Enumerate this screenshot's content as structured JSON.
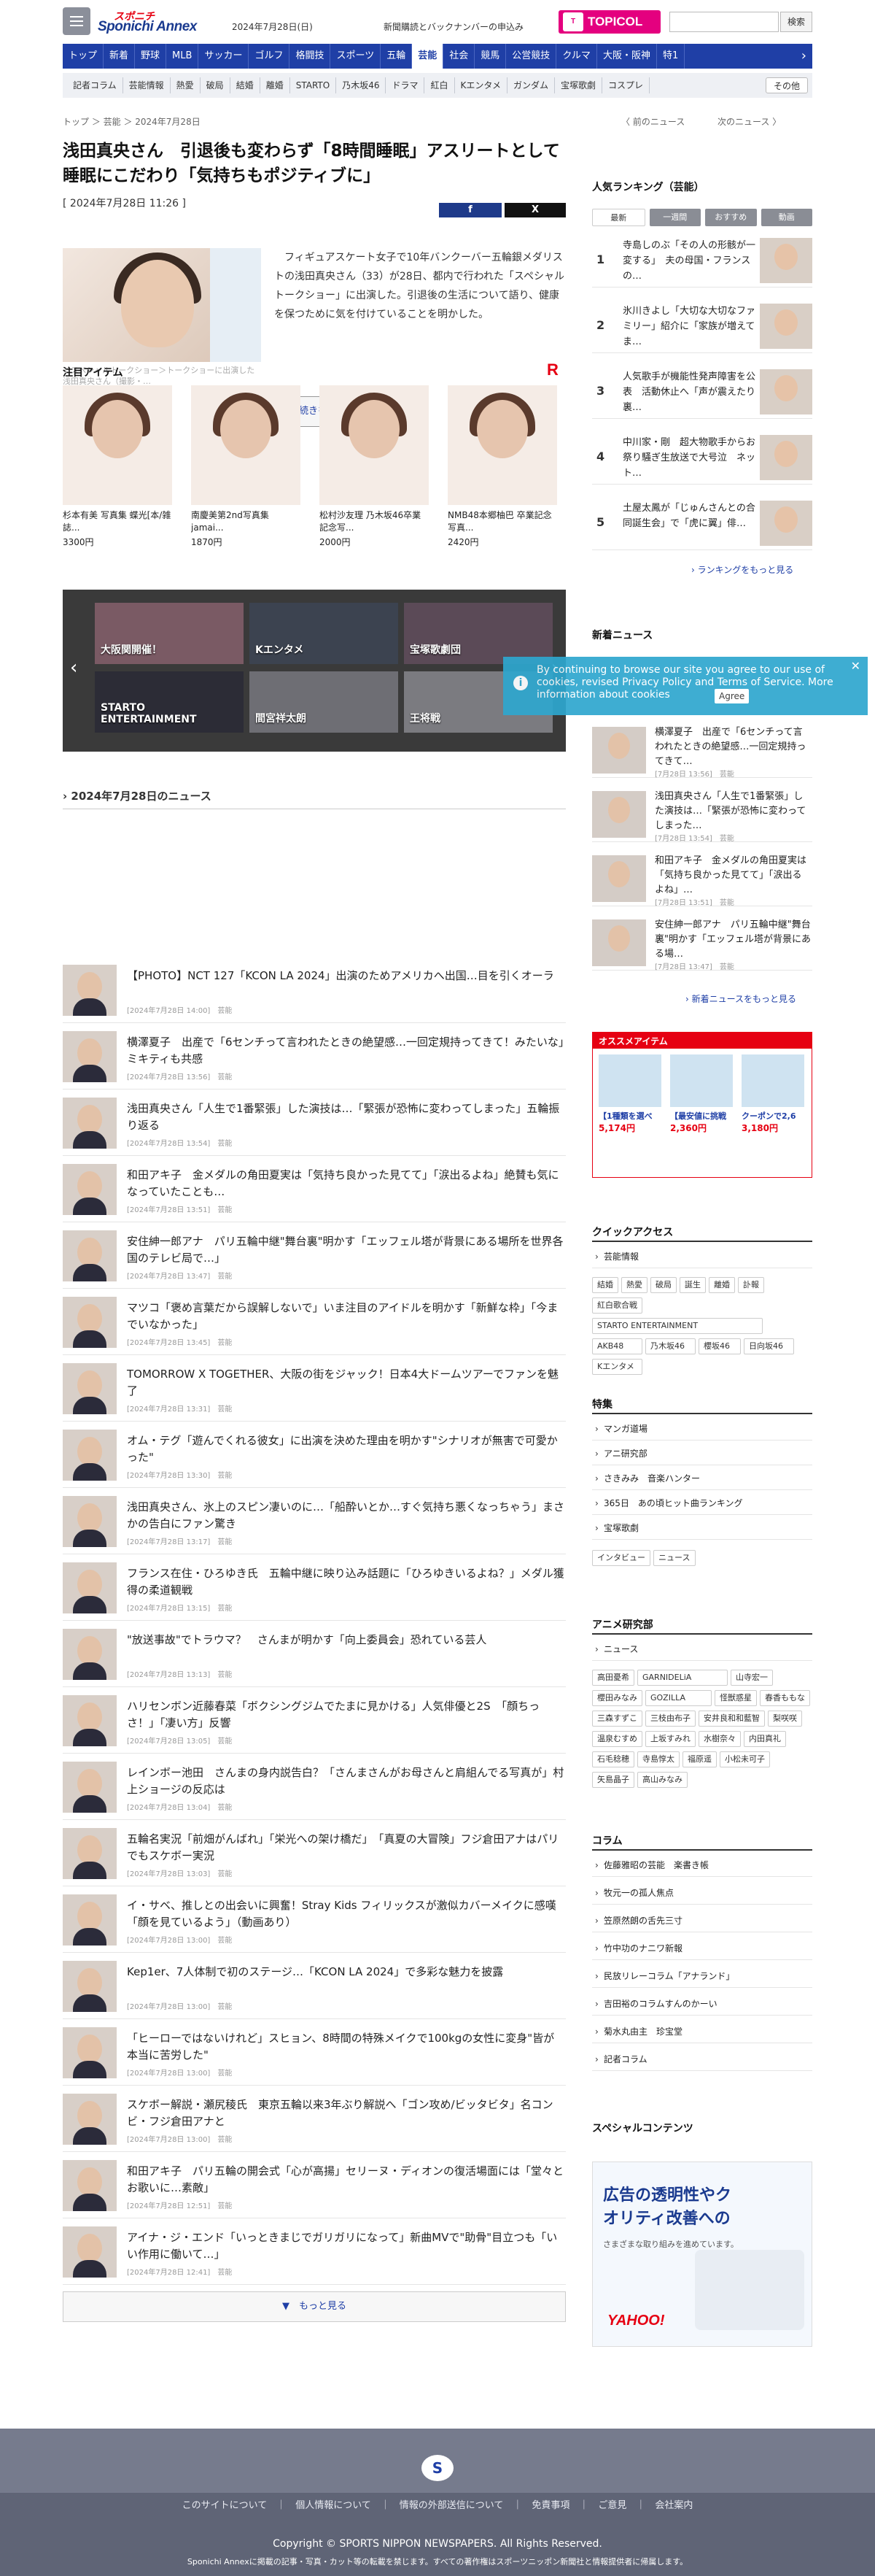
{
  "header": {
    "logo_top": "スポニチ",
    "logo_main": "Sponichi Annex",
    "date": "2024年7月28日(日)",
    "news_link": "新聞購読とバックナンバーの申込み",
    "topicol": "TOPICOL",
    "search_placeholder": "",
    "search_btn": "検索"
  },
  "nav": [
    "トップ",
    "新着",
    "野球",
    "MLB",
    "サッカー",
    "ゴルフ",
    "格闘技",
    "スポーツ",
    "五輪",
    "芸能",
    "社会",
    "競馬",
    "公営競技",
    "クルマ",
    "大阪・阪神",
    "特1"
  ],
  "subnav": [
    "記者コラム",
    "芸能情報",
    "熱愛",
    "破局",
    "結婚",
    "離婚",
    "STARTO",
    "乃木坂46",
    "ドラマ",
    "紅白",
    "Kエンタメ",
    "ガンダム",
    "宝塚歌劇",
    "コスプレ"
  ],
  "subnav_more": "その他",
  "breadcrumb": "トップ ＞ 芸能 ＞ 2024年7月28日",
  "prev": "〈 前のニュース",
  "next": "次のニュース 〉",
  "article": {
    "title": "浅田真央さん　引退後も変わらず「8時間睡眠」アスリートとして睡眠にこだわり「気持ちもポジティブに」",
    "date": "[ 2024年7月28日 11:26 ]",
    "lead": "フィギュアスケート女子で10年バンクーバー五輪銀メダリストの浅田真央さん（33）が28日、都内で行われた「スペシャルトークショー」に出演した。引退後の生活について語り、健康を保つために気を付けていることを明かした。",
    "caption": "＜スペシャルトークショー＞トークショーに出演した浅田真央さん（撮影・…",
    "more": "▼　続きを表示",
    "share_fb": "f",
    "share_x": "X"
  },
  "featured": {
    "title": "注目アイテム",
    "items": [
      {
        "name": "杉本有美 写真集 蝶光[本/雑誌...",
        "price": "3300円"
      },
      {
        "name": "南慶美第2nd写真集 jamai...",
        "price": "1870円"
      },
      {
        "name": "松村沙友理 乃木坂46卒業記念写...",
        "price": "2000円"
      },
      {
        "name": "NMB48本郷柚巴 卒業記念写真...",
        "price": "2420円"
      }
    ]
  },
  "carousel": [
    "大阪関開催！",
    "Kエンタメ",
    "宝塚歌劇団",
    "STARTO ENTERTAINMENT",
    "間宮祥太朗",
    "王将戦"
  ],
  "news": {
    "title": "2024年7月28日のニュース",
    "items": [
      {
        "t": "【PHOTO】NCT 127「KCON LA 2024」出演のためアメリカへ出国…目を引くオーラ",
        "d": "[2024年7月28日 14:00]　芸能"
      },
      {
        "t": "横澤夏子　出産で「6センチって言われたときの絶望感…一回定規持ってきて！みたいな」ミキティも共感",
        "d": "[2024年7月28日 13:56]　芸能"
      },
      {
        "t": "浅田真央さん「人生で1番緊張」した演技は…「緊張が恐怖に変わってしまった」五輪振り返る",
        "d": "[2024年7月28日 13:54]　芸能"
      },
      {
        "t": "和田アキ子　金メダルの角田夏実は「気持ち良かった見てて」「涙出るよね」絶賛も気になっていたことも…",
        "d": "[2024年7月28日 13:51]　芸能"
      },
      {
        "t": "安住紳一郎アナ　パリ五輪中継\"舞台裏\"明かす「エッフェル塔が背景にある場所を世界各国のテレビ局で…」",
        "d": "[2024年7月28日 13:47]　芸能"
      },
      {
        "t": "マツコ「褒め言葉だから誤解しないで」いま注目のアイドルを明かす「新鮮な枠」「今までいなかった」",
        "d": "[2024年7月28日 13:45]　芸能"
      },
      {
        "t": "TOMORROW X TOGETHER、大阪の街をジャック！日本4大ドームツアーでファンを魅了",
        "d": "[2024年7月28日 13:31]　芸能"
      },
      {
        "t": "オム・テグ「遊んでくれる彼女」に出演を決めた理由を明かす\"シナリオが無害で可愛かった\"",
        "d": "[2024年7月28日 13:30]　芸能"
      },
      {
        "t": "浅田真央さん、氷上のスピン凄いのに…「船酔いとか…すぐ気持ち悪くなっちゃう」まさかの告白にファン驚き",
        "d": "[2024年7月28日 13:17]　芸能"
      },
      {
        "t": "フランス在住・ひろゆき氏　五輪中継に映り込み話題に「ひろゆきいるよね？」メダル獲得の柔道観戦",
        "d": "[2024年7月28日 13:15]　芸能"
      },
      {
        "t": "\"放送事故\"でトラウマ？　さんまが明かす「向上委員会」恐れている芸人",
        "d": "[2024年7月28日 13:13]　芸能"
      },
      {
        "t": "ハリセンボン近藤春菜「ボクシングジムでたまに見かける」人気俳優と2S　「顔ちっさ！」「凄い方」反響",
        "d": "[2024年7月28日 13:05]　芸能"
      },
      {
        "t": "レインボー池田　さんまの身内説告白？「さんまさんがお母さんと肩組んでる写真が」村上ショージの反応は",
        "d": "[2024年7月28日 13:04]　芸能"
      },
      {
        "t": "五輪名実況「前畑がんばれ」「栄光への架け橋だ」　「真夏の大冒険」フジ倉田アナはパリでもスケボー実況",
        "d": "[2024年7月28日 13:03]　芸能"
      },
      {
        "t": "イ・サベ、推しとの出会いに興奮！Stray Kids フィリックスが激似カバーメイクに感嘆「顔を見ているよう」（動画あり）",
        "d": "[2024年7月28日 13:00]　芸能"
      },
      {
        "t": "Kep1er、7人体制で初のステージ…「KCON LA 2024」で多彩な魅力を披露",
        "d": "[2024年7月28日 13:00]　芸能"
      },
      {
        "t": "「ヒーローではないけれど」スヒョン、8時間の特殊メイクで100kgの女性に変身\"皆が本当に苦労した\"",
        "d": "[2024年7月28日 13:00]　芸能"
      },
      {
        "t": "スケボー解説・瀬尻稜氏　東京五輪以来3年ぶり解説へ「ゴン攻め/ビッタビタ」名コンビ・フジ倉田アナと",
        "d": "[2024年7月28日 13:00]　芸能"
      },
      {
        "t": "和田アキ子　パリ五輪の開会式「心が高揚」セリーヌ・ディオンの復活場面には「堂々とお歌いに…素敵」",
        "d": "[2024年7月28日 12:51]　芸能"
      },
      {
        "t": "アイナ・ジ・エンド「いっときまじでガリガリになって」新曲MVで\"助骨\"目立つも「いい作用に働いて…」",
        "d": "[2024年7月28日 12:41]　芸能"
      }
    ]
  },
  "news_more": "▼　もっと見る",
  "ranking": {
    "title": "人気ランキング（芸能）",
    "tabs": [
      "最新",
      "一週間",
      "おすすめ",
      "動画"
    ],
    "items": [
      {
        "n": "1",
        "t": "寺島しのぶ「その人の形骸が一変する」　夫の母国・フランスの…"
      },
      {
        "n": "2",
        "t": "氷川きよし「大切な大切なファミリー」紹介に「家族が増えてま…"
      },
      {
        "n": "3",
        "t": "人気歌手が機能性発声障害を公表　活動休止へ「声が震えたり裏…"
      },
      {
        "n": "4",
        "t": "中川家・剛　超大物歌手からお祭り騒ぎ生放送で大号泣　ネット…"
      },
      {
        "n": "5",
        "t": "土屋太鳳が「じゅんさんとの合同誕生会」で「虎に翼」俳…"
      }
    ],
    "more": "ランキングをもっと見る"
  },
  "latest": {
    "title": "新着ニュース",
    "items": [
      {
        "t": "横澤夏子　出産で「6センチって言われたときの絶望感…一回定規持ってきて…",
        "d": "[7月28日 13:56]　芸能"
      },
      {
        "t": "浅田真央さん「人生で1番緊張」した演技は…「緊張が恐怖に変わってしまった…",
        "d": "[7月28日 13:54]　芸能"
      },
      {
        "t": "和田アキ子　金メダルの角田夏実は「気持ち良かった見てて」「涙出るよね」…",
        "d": "[7月28日 13:51]　芸能"
      },
      {
        "t": "安住紳一郎アナ　パリ五輪中継\"舞台裏\"明かす「エッフェル塔が背景にある場…",
        "d": "[7月28日 13:47]　芸能"
      }
    ],
    "more": "新着ニュースをもっと見る"
  },
  "cookie": {
    "text": "By continuing to browse our site you agree to our use of cookies, revised Privacy Policy and Terms of Service. More information about cookies",
    "agree": "Agree"
  },
  "osusume": {
    "title": "オススメアイテム",
    "items": [
      {
        "l": "【1種類を選べ",
        "p": "5,174円"
      },
      {
        "l": "【最安値に挑戦",
        "p": "2,360円"
      },
      {
        "l": "クーポンで2,6",
        "p": "3,180円"
      }
    ]
  },
  "quick": {
    "title": "クイックアクセス",
    "link": "芸能情報",
    "tags": [
      "結婚",
      "熱愛",
      "破局",
      "誕生",
      "離婚",
      "訃報",
      "紅白歌合戦",
      "STARTO ENTERTAINMENT",
      "AKB48",
      "乃木坂46",
      "櫻坂46",
      "日向坂46",
      "Kエンタメ"
    ]
  },
  "special": {
    "title": "特集",
    "items": [
      "マンガ道場",
      "アニ研究部",
      "さきみみ　音楽ハンター",
      "365日　あの頃ヒット曲ランキング",
      "宝塚歌劇"
    ],
    "tags": [
      "インタビュー",
      "ニュース"
    ]
  },
  "anime": {
    "title": "アニメ研究部",
    "link": "ニュース",
    "tags": [
      "高田憂希",
      "GARNIDELiA",
      "山寺宏一",
      "櫻田みなみ",
      "GOZILLA",
      "怪獣惑星",
      "春香ももな",
      "三森すずこ",
      "三枝由布子",
      "安井良和和藍智",
      "梨咲咲",
      "温泉むすめ",
      "上坂すみれ",
      "水樹奈々",
      "内田真礼",
      "石毛稔穂",
      "寺島惇太",
      "福原遥",
      "小松未可子",
      "矢島晶子",
      "高山みなみ"
    ]
  },
  "column": {
    "title": "コラム",
    "items": [
      "佐藤雅昭の芸能　楽書き帳",
      "牧元一の孤人焦点",
      "笠原然朗の舌先三寸",
      "竹中功のナニワ新報",
      "民放リレーコラム「アナランド」",
      "吉田裕のコラムすんのかーい",
      "菊水丸由主　珍宝堂",
      "記者コラム"
    ]
  },
  "spcontent": {
    "title": "スペシャルコンテンツ",
    "ad1": "広告の透明性やクオリティ改善への",
    "ad2": "さまざまな取り組みを進めています。",
    "ad3": "YAHOO!"
  },
  "footer": {
    "links": "このサイトについて　｜　個人情報について　｜　情報の外部送信について　｜　免責事項　｜　ご意見　｜　会社案内",
    "copyright": "Copyright © SPORTS NIPPON NEWSPAPERS. All Rights Reserved.",
    "note": "Sponichi Annexに掲載の記事・写真・カット等の転載を禁じます。すべての著作権はスポーツニッポン新聞社と情報提供者に帰属します。",
    "emblem": "S"
  }
}
